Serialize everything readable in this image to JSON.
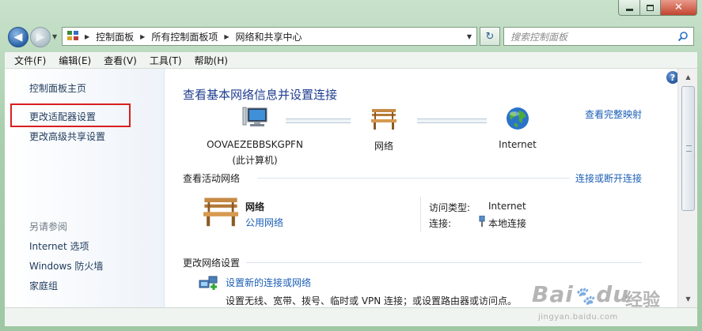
{
  "address": {
    "crumbs": [
      "控制面板",
      "所有控制面板项",
      "网络和共享中心"
    ]
  },
  "search": {
    "placeholder": "搜索控制面板"
  },
  "menu": [
    "文件(F)",
    "编辑(E)",
    "查看(V)",
    "工具(T)",
    "帮助(H)"
  ],
  "sidebar": {
    "links": [
      "控制面板主页",
      "更改适配器设置",
      "更改高级共享设置"
    ],
    "see_also_header": "另请参阅",
    "see_also": [
      "Internet 选项",
      "Windows 防火墙",
      "家庭组"
    ]
  },
  "main": {
    "title": "查看基本网络信息并设置连接",
    "full_map_link": "查看完整映射",
    "map": {
      "computer_name": "OOVAEZEBBSKGPFN",
      "computer_sub": "(此计算机)",
      "network": "网络",
      "internet": "Internet"
    },
    "active": {
      "title": "查看活动网络",
      "connect_link": "连接或断开连接",
      "network_name": "网络",
      "network_type": "公用网络",
      "access_label": "访问类型:",
      "access_value": "Internet",
      "conn_label": "连接:",
      "conn_value": "本地连接"
    },
    "change": {
      "title": "更改网络设置",
      "task_link": "设置新的连接或网络",
      "task_desc": "设置无线、宽带、拨号、临时或 VPN 连接；或设置路由器或访问点。"
    },
    "help_glyph": "?"
  },
  "watermark": {
    "logo": "Bai",
    "logo2": "du",
    "jingyan": "经验",
    "url": "jingyan.baidu.com"
  },
  "colors": {
    "frame": "#a9cfae",
    "link": "#1c5fb5",
    "title": "#1e3d8f",
    "highlight": "#d91f1f"
  }
}
